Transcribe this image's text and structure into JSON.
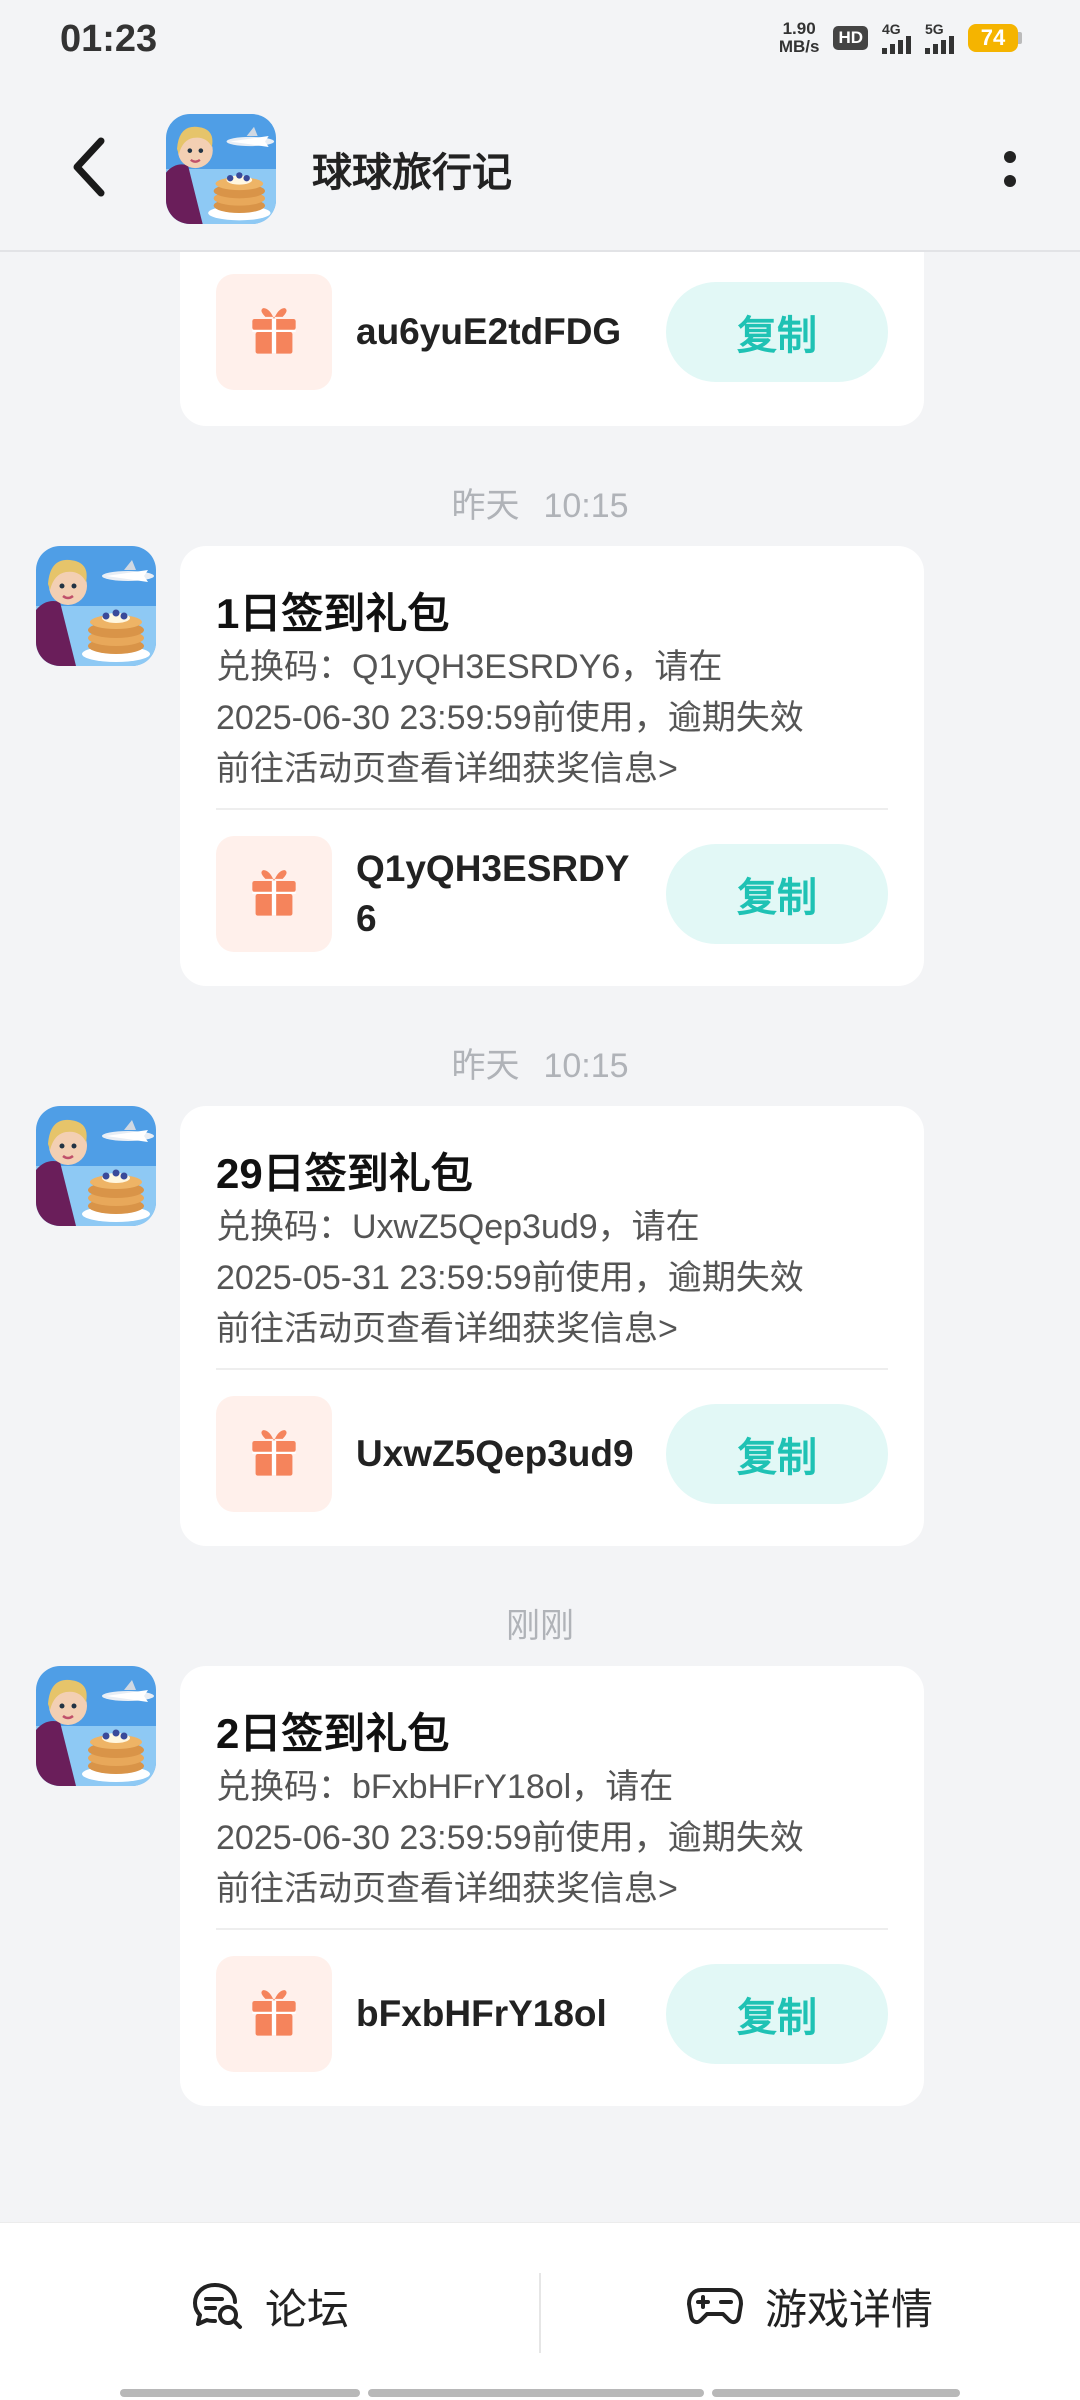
{
  "status_bar": {
    "time": "01:23",
    "net_speed_value": "1.90",
    "net_speed_unit": "MB/s",
    "hd_label": "HD",
    "sim1_label": "4G",
    "sim2_label": "5G",
    "battery": "74"
  },
  "header": {
    "title": "球球旅行记",
    "back_icon": "back-arrow-icon",
    "more_icon": "more-vertical-icon"
  },
  "messages": [
    {
      "title": "",
      "code": "au6yuE2tdFDG",
      "copy_label": "复制"
    },
    {
      "time_day": "昨天",
      "time_clock": "10:15",
      "title": "1日签到礼包",
      "desc_line1": "兑换码：Q1yQH3ESRDY6，请在",
      "desc_line2": "2025-06-30 23:59:59前使用，逾期失效",
      "desc_line3": "前往活动页查看详细获奖信息>",
      "code": "Q1yQH3ESRDY6",
      "copy_label": "复制"
    },
    {
      "time_day": "昨天",
      "time_clock": "10:15",
      "title": "29日签到礼包",
      "desc_line1": "兑换码：UxwZ5Qep3ud9，请在",
      "desc_line2": "2025-05-31 23:59:59前使用，逾期失效",
      "desc_line3": "前往活动页查看详细获奖信息>",
      "code": "UxwZ5Qep3ud9",
      "copy_label": "复制"
    },
    {
      "time_day": "刚刚",
      "title": "2日签到礼包",
      "desc_line1": "兑换码：bFxbHFrY18ol，请在",
      "desc_line2": "2025-06-30 23:59:59前使用，逾期失效",
      "desc_line3": "前往活动页查看详细获奖信息>",
      "code": "bFxbHFrY18ol",
      "copy_label": "复制"
    }
  ],
  "bottom_bar": {
    "forum_label": "论坛",
    "forum_icon": "chat-search-icon",
    "details_label": "游戏详情",
    "details_icon": "gamepad-icon"
  },
  "colors": {
    "accent": "#1fc2b4",
    "copy_bg": "#e2f8f6",
    "gift": "#f5845c",
    "gift_bg": "#fff0eb",
    "battery": "#f5b400"
  }
}
